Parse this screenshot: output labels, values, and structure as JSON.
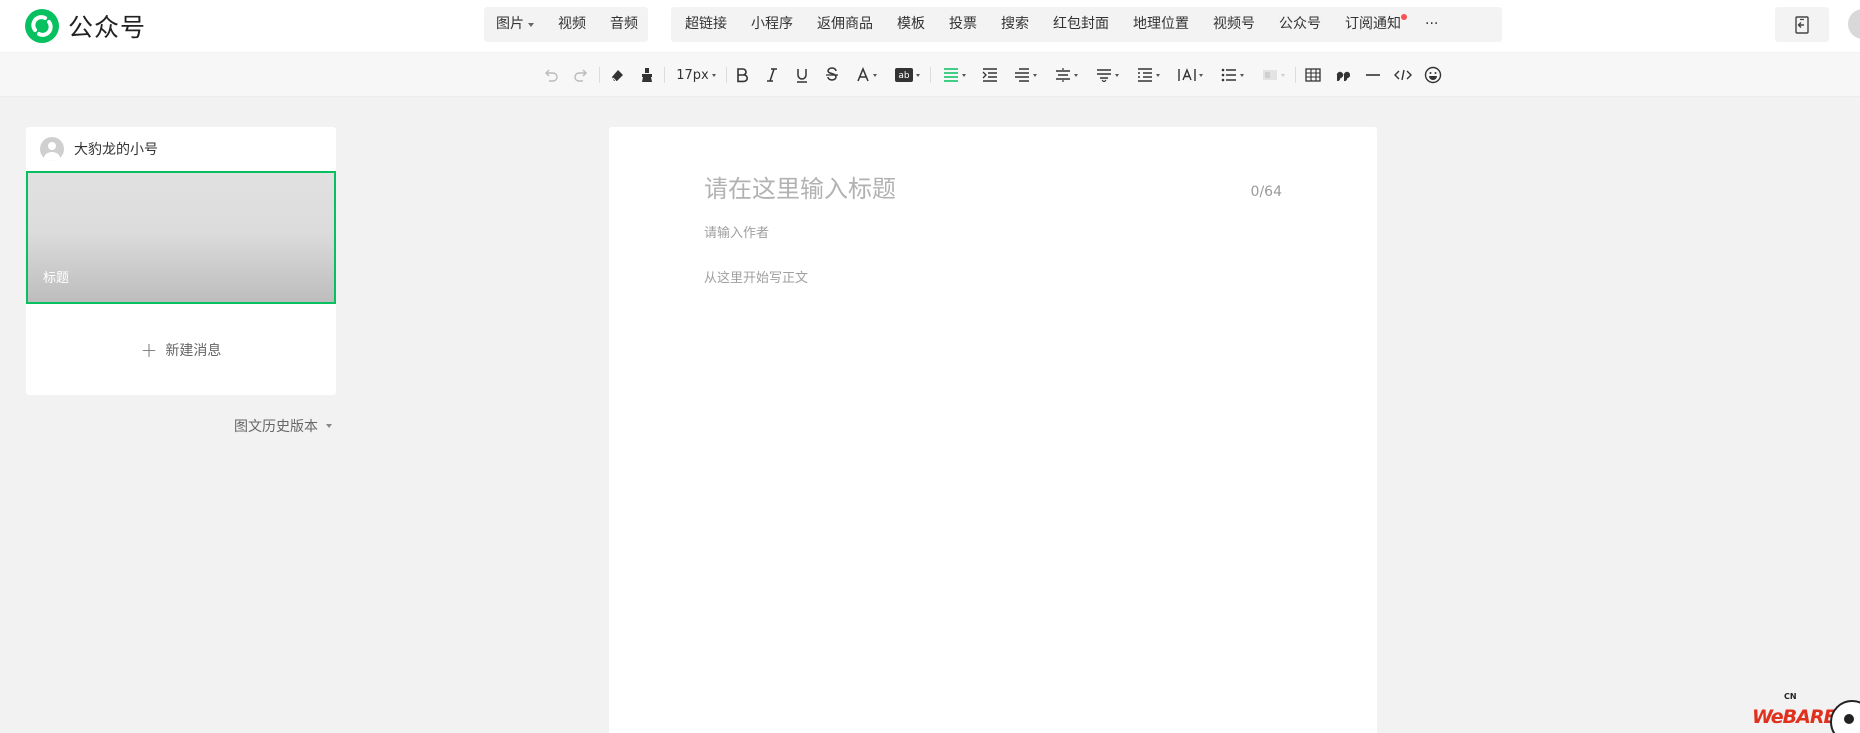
{
  "app": {
    "name": "公众号"
  },
  "insert_bar": {
    "media": [
      {
        "label": "图片",
        "has_dropdown": true
      },
      {
        "label": "视频",
        "has_dropdown": false
      },
      {
        "label": "音频",
        "has_dropdown": false
      }
    ],
    "features": [
      {
        "label": "超链接"
      },
      {
        "label": "小程序"
      },
      {
        "label": "返佣商品"
      },
      {
        "label": "模板"
      },
      {
        "label": "投票"
      },
      {
        "label": "搜索"
      },
      {
        "label": "红包封面"
      },
      {
        "label": "地理位置"
      },
      {
        "label": "视频号"
      },
      {
        "label": "公众号"
      },
      {
        "label": "订阅通知",
        "badge": true
      }
    ],
    "more_label": "···"
  },
  "toolbar": {
    "font_size": "17px",
    "icons": [
      "undo-icon",
      "redo-icon",
      "eraser-icon",
      "format-brush-icon",
      "font-size-select",
      "bold-icon",
      "italic-icon",
      "underline-icon",
      "strikethrough-icon",
      "font-color-icon",
      "background-color-icon",
      "align-icon",
      "indent-icon",
      "first-line-indent-icon",
      "line-height-icon",
      "paragraph-spacing-icon",
      "block-indent-icon",
      "letter-spacing-icon",
      "list-icon",
      "disabled-format-icon",
      "table-icon",
      "quote-icon",
      "divider-icon",
      "code-icon",
      "emoji-icon"
    ],
    "accent_color": "#07c160"
  },
  "sidebar": {
    "account_name": "大豹龙的小号",
    "article_title": "标题",
    "new_message_label": "新建消息",
    "history_label": "图文历史版本"
  },
  "editor": {
    "title_placeholder": "请在这里输入标题",
    "title_counter": "0/64",
    "author_placeholder": "请输入作者",
    "body_placeholder": "从这里开始写正文"
  },
  "mascot": {
    "text": "WeBARE",
    "small_text": "CN"
  },
  "colors": {
    "accent": "#07c160",
    "badge": "#fa5151",
    "background": "#f2f2f2"
  }
}
